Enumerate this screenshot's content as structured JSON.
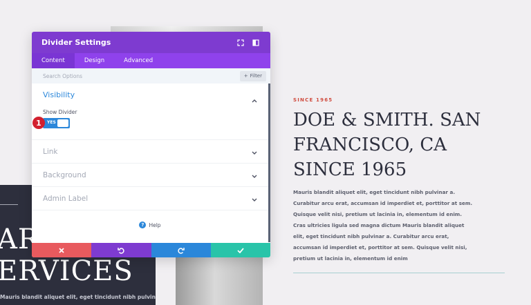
{
  "background": {
    "dark_panel": {
      "big_line_1": "ARA",
      "big_line_2": "ERVICES",
      "small_text": "Mauris blandit aliquet elit, eget tincidunt nibh pulvinar a."
    },
    "article": {
      "eyebrow": "SINCE 1965",
      "heading": "DOE & SMITH. SAN FRANCISCO, CA SINCE 1965",
      "body": "Mauris blandit aliquet elit, eget tincidunt nibh pulvinar a. Curabitur arcu erat, accumsan id imperdiet et, porttitor at sem. Quisque velit nisi, pretium ut lacinia in, elementum id enim. Cras ultricies ligula sed magna dictum Mauris blandit aliquet elit, eget tincidunt nibh pulvinar a. Curabitur arcu erat, accumsan id imperdiet et, porttitor at sem. Quisque velit nisi, pretium ut lacinia in, elementum id enim"
    }
  },
  "modal": {
    "title": "Divider Settings",
    "header_icons": [
      "expand-icon",
      "sidebar-toggle-icon"
    ],
    "tabs": [
      {
        "label": "Content",
        "active": true
      },
      {
        "label": "Design",
        "active": false
      },
      {
        "label": "Advanced",
        "active": false
      }
    ],
    "search": {
      "placeholder": "Search Options",
      "value": ""
    },
    "filter_label": "Filter",
    "sections": {
      "visibility": {
        "title": "Visibility",
        "field_label": "Show Divider",
        "toggle_value": "YES",
        "badge": "1"
      },
      "link": {
        "title": "Link"
      },
      "background": {
        "title": "Background"
      },
      "admin_label": {
        "title": "Admin Label"
      }
    },
    "help_label": "Help",
    "footer": {
      "colors": {
        "discard": "#e85a5e",
        "undo": "#7e3bd0",
        "redo": "#2b87da",
        "save": "#29c4a9"
      }
    }
  },
  "colors": {
    "header": "#7e3bd0",
    "tabs": "#8f42ec",
    "accent_blue": "#2b87da",
    "eyebrow_red": "#d04b3e"
  }
}
